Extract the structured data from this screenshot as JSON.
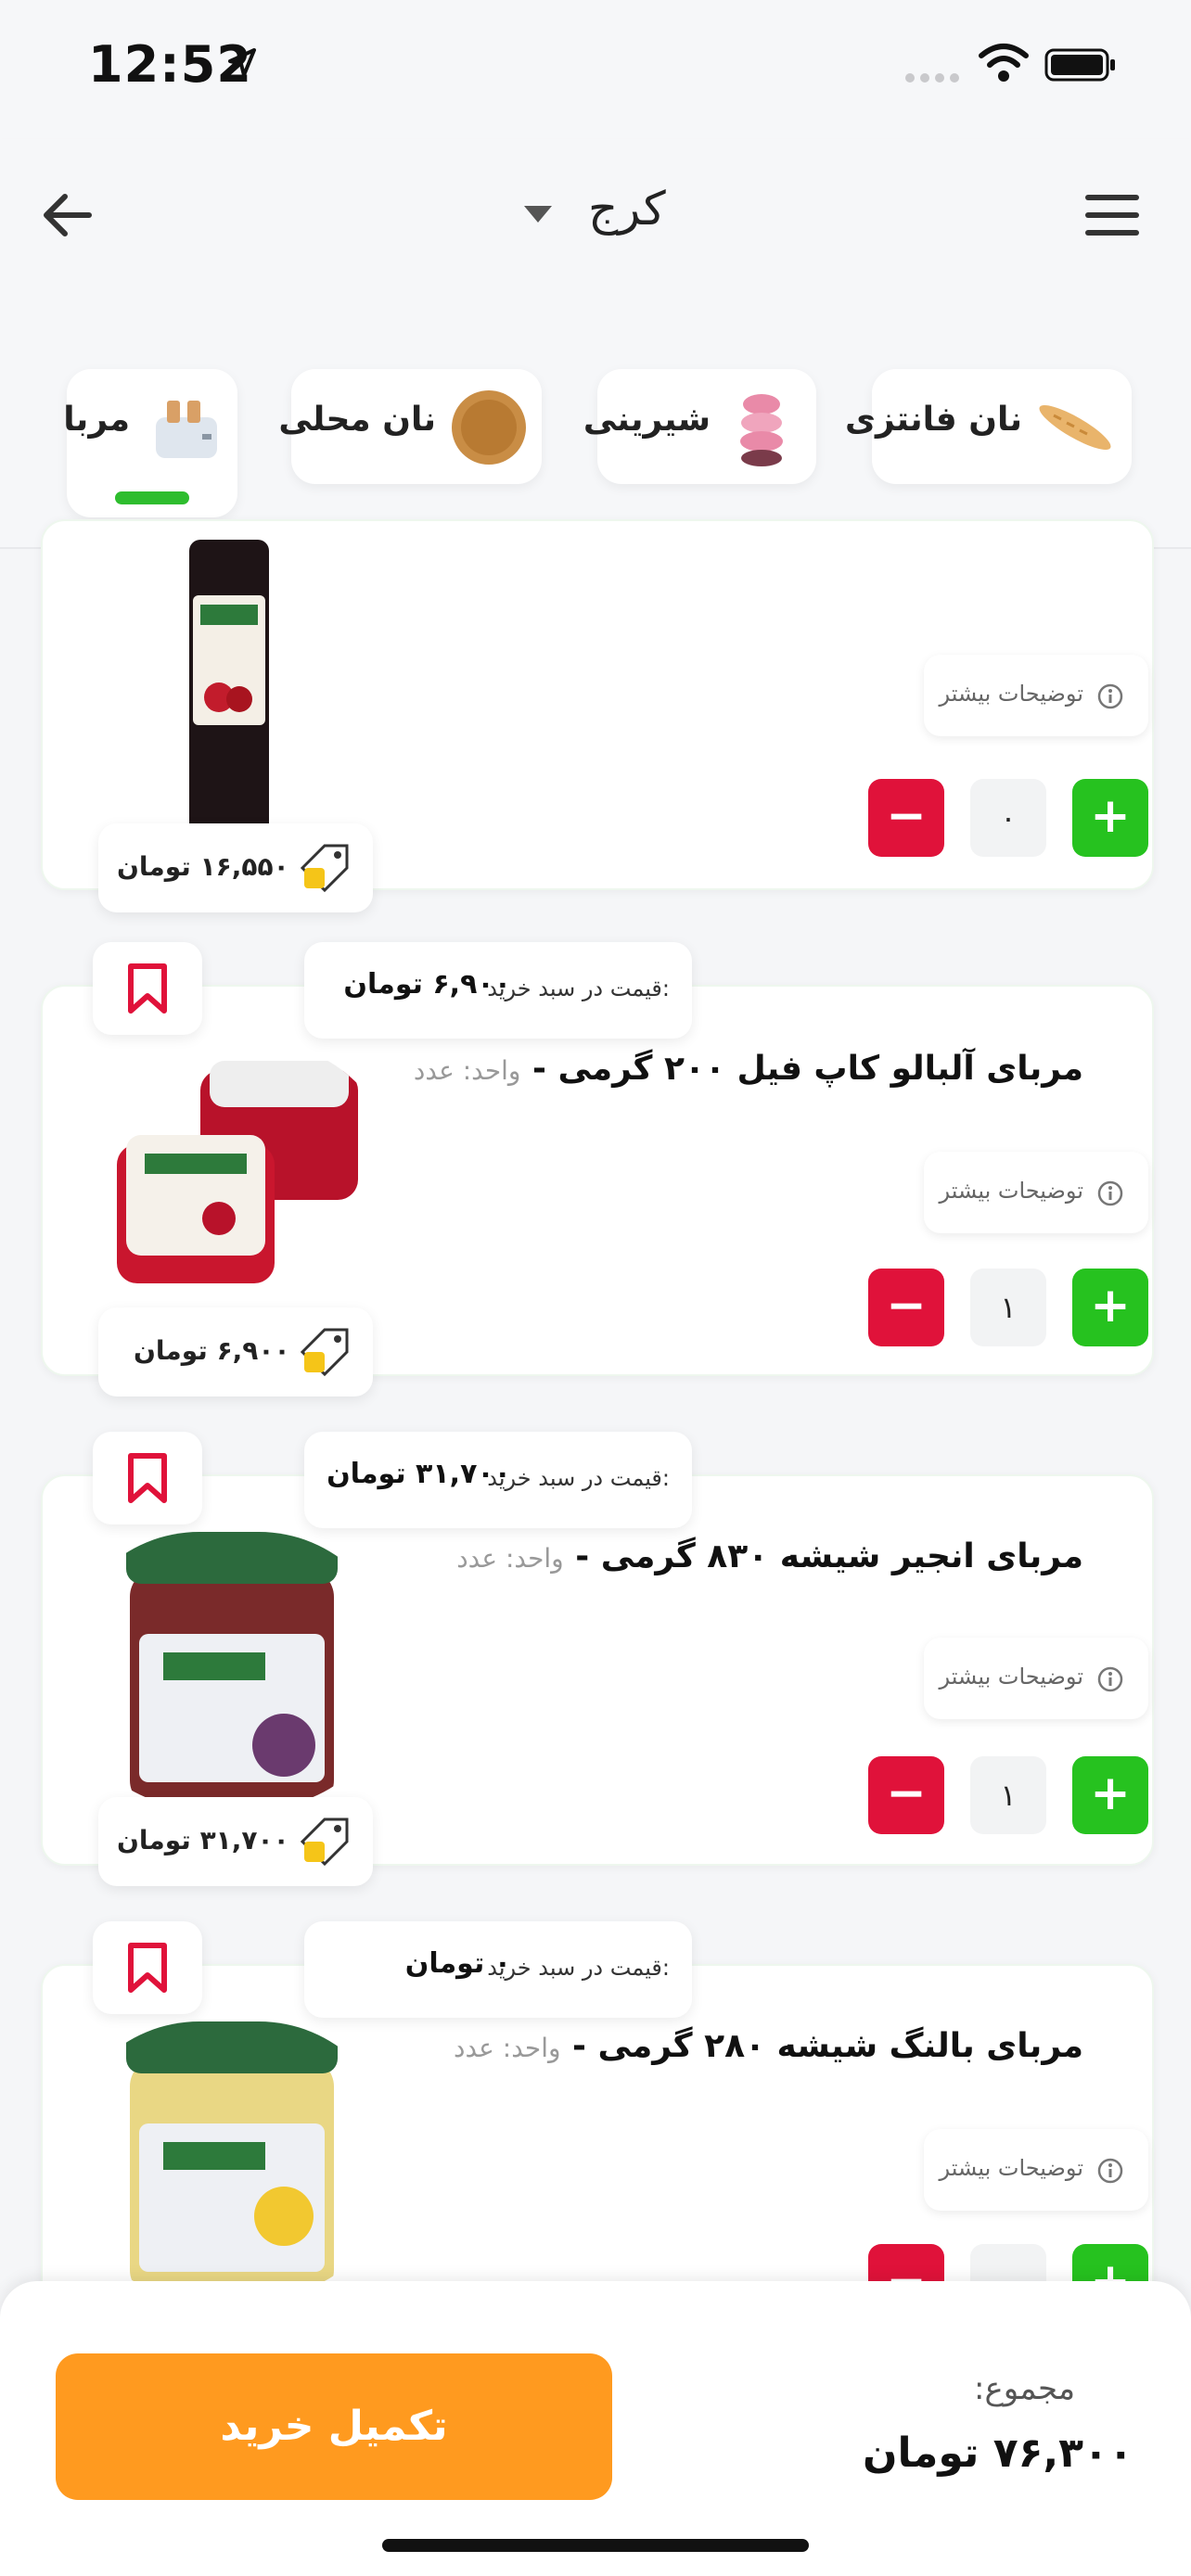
{
  "status_bar": {
    "time": "12:52"
  },
  "header": {
    "city": "کرج"
  },
  "categories": [
    {
      "label": "نان فانتزی"
    },
    {
      "label": "شیرینی"
    },
    {
      "label": "نان محلی"
    },
    {
      "label": "مربا",
      "selected": true
    }
  ],
  "products": [
    {
      "name": "",
      "unit": "",
      "price": "۱۶,۵۵۰ تومان",
      "qty": "۰",
      "more_label": "توضیحات بیشتر"
    },
    {
      "cart_label": "قیمت در سبد خرید:",
      "cart_price": "۶,۹۰۰ تومان",
      "name": "مربای آلبالو کاپ فیل ۲۰۰ گرمی",
      "unit": "واحد: عدد",
      "more_label": "توضیحات بیشتر",
      "qty": "۱",
      "price": "۶,۹۰۰ تومان"
    },
    {
      "cart_label": "قیمت در سبد خرید:",
      "cart_price": "۳۱,۷۰۰ تومان",
      "name": "مربای انجیر شیشه ۸۳۰ گرمی",
      "unit": "واحد: عدد",
      "more_label": "توضیحات بیشتر",
      "qty": "۱",
      "price": "۳۱,۷۰۰ تومان"
    },
    {
      "cart_label": "قیمت در سبد خرید:",
      "cart_price": "۰ تومان",
      "name": "مربای بالنگ شیشه ۲۸۰ گرمی",
      "unit": "واحد: عدد",
      "more_label": "توضیحات بیشتر"
    }
  ],
  "footer": {
    "total_label": "مجموع:",
    "total_value": "۷۶,۳۰۰ تومان",
    "checkout_label": "تکمیل خرید"
  },
  "colors": {
    "accent_orange": "#ff9a1f",
    "green": "#26c21f",
    "red": "#e0123a"
  }
}
